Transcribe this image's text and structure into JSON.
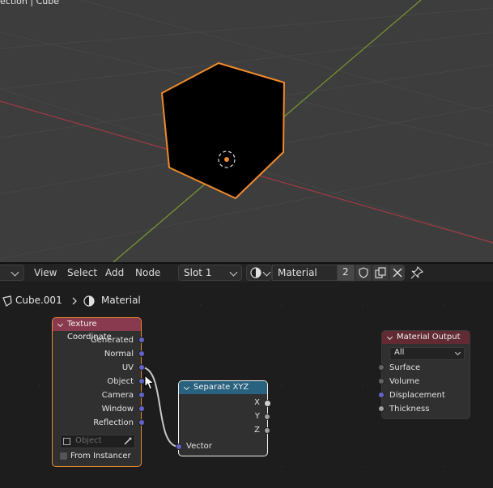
{
  "viewport": {
    "title": "ection | Cube"
  },
  "header": {
    "menu": [
      "View",
      "Select",
      "Add",
      "Node"
    ],
    "slot_label": "Slot 1",
    "material_name": "Material",
    "user_count": "2"
  },
  "breadcrumb": {
    "object": "Cube.001",
    "material": "Material"
  },
  "nodes": {
    "texture_coordinate": {
      "title": "Texture Coordinate",
      "outputs": [
        "Generated",
        "Normal",
        "UV",
        "Object",
        "Camera",
        "Window",
        "Reflection"
      ],
      "object_placeholder": "Object",
      "from_instancer": "From Instancer"
    },
    "separate_xyz": {
      "title": "Separate XYZ",
      "outputs": [
        "X",
        "Y",
        "Z"
      ],
      "input": "Vector"
    },
    "material_output": {
      "title": "Material Output",
      "target": "All",
      "inputs": [
        "Surface",
        "Volume",
        "Displacement",
        "Thickness"
      ]
    }
  },
  "colors": {
    "texture_head": "#8a3a4f",
    "separate_head": "#29627f",
    "output_head": "#622a33",
    "selection": "#ef8a2a",
    "active": "#ffffff"
  }
}
